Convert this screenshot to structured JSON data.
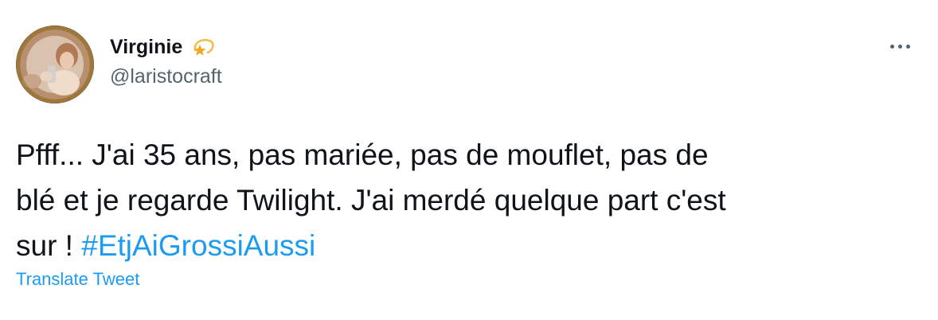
{
  "tweet": {
    "author": {
      "display_name": "Virginie",
      "name_emoji": "dizzy-star-emoji",
      "handle": "@laristocraft",
      "avatar": "profile-photo"
    },
    "more_icon": "more-horizontal-icon",
    "text_lines": [
      "Pfff... J'ai 35 ans, pas mariée, pas de mouflet, pas de",
      "blé et je regarde Twilight. J'ai merdé quelque part c'est",
      "sur ! "
    ],
    "hashtag": "#EtjAiGrossiAussi",
    "translate_label": "Translate Tweet"
  },
  "colors": {
    "text": "#0f1419",
    "secondary": "#536471",
    "link": "#1d9bf0"
  }
}
